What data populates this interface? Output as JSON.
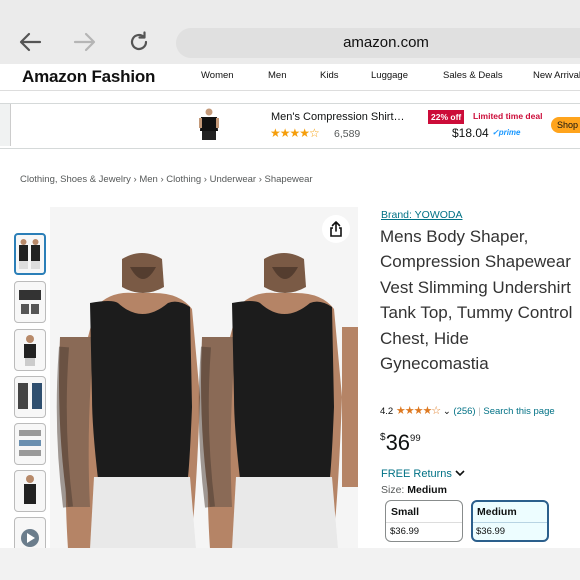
{
  "browser": {
    "url": "amazon.com",
    "back_icon": "arrow-left-icon",
    "forward_icon": "arrow-right-icon",
    "reload_icon": "reload-icon"
  },
  "header": {
    "brand": "Amazon Fashion",
    "categories": [
      "Women",
      "Men",
      "Kids",
      "Luggage",
      "Sales & Deals",
      "New Arrivals"
    ]
  },
  "sponsored": {
    "title": "Men's Compression Shirt…",
    "stars": "★★★★☆",
    "rating_count": "6,589",
    "discount": "22% off",
    "deal_label": "Limited time deal",
    "price": "$18.04",
    "prime": "✓prime",
    "shop_label": "Shop"
  },
  "breadcrumb": [
    "Clothing, Shoes & Jewelry",
    "Men",
    "Clothing",
    "Underwear",
    "Shapewear"
  ],
  "product": {
    "brand_link": "Brand: YOWODA",
    "title": "Mens Body Shaper, Compression Shapewear Vest Slimming Undershirt Tank Top, Tummy Control Chest, Hide Gynecomastia",
    "rating": "4.2",
    "stars": "★★★★☆",
    "review_count": "(256)",
    "search_link": "Search this page",
    "price_symbol": "$",
    "price_whole": "36",
    "price_fraction": "99",
    "returns": "FREE Returns",
    "size_label": "Size:",
    "size_selected": "Medium",
    "sizes": [
      {
        "name": "Small",
        "price": "$36.99"
      },
      {
        "name": "Medium",
        "price": "$36.99"
      }
    ]
  },
  "colors": {
    "link": "#007185",
    "accent_orange": "#ffa41c",
    "deal_red": "#cc0c39",
    "star": "#de7921"
  }
}
